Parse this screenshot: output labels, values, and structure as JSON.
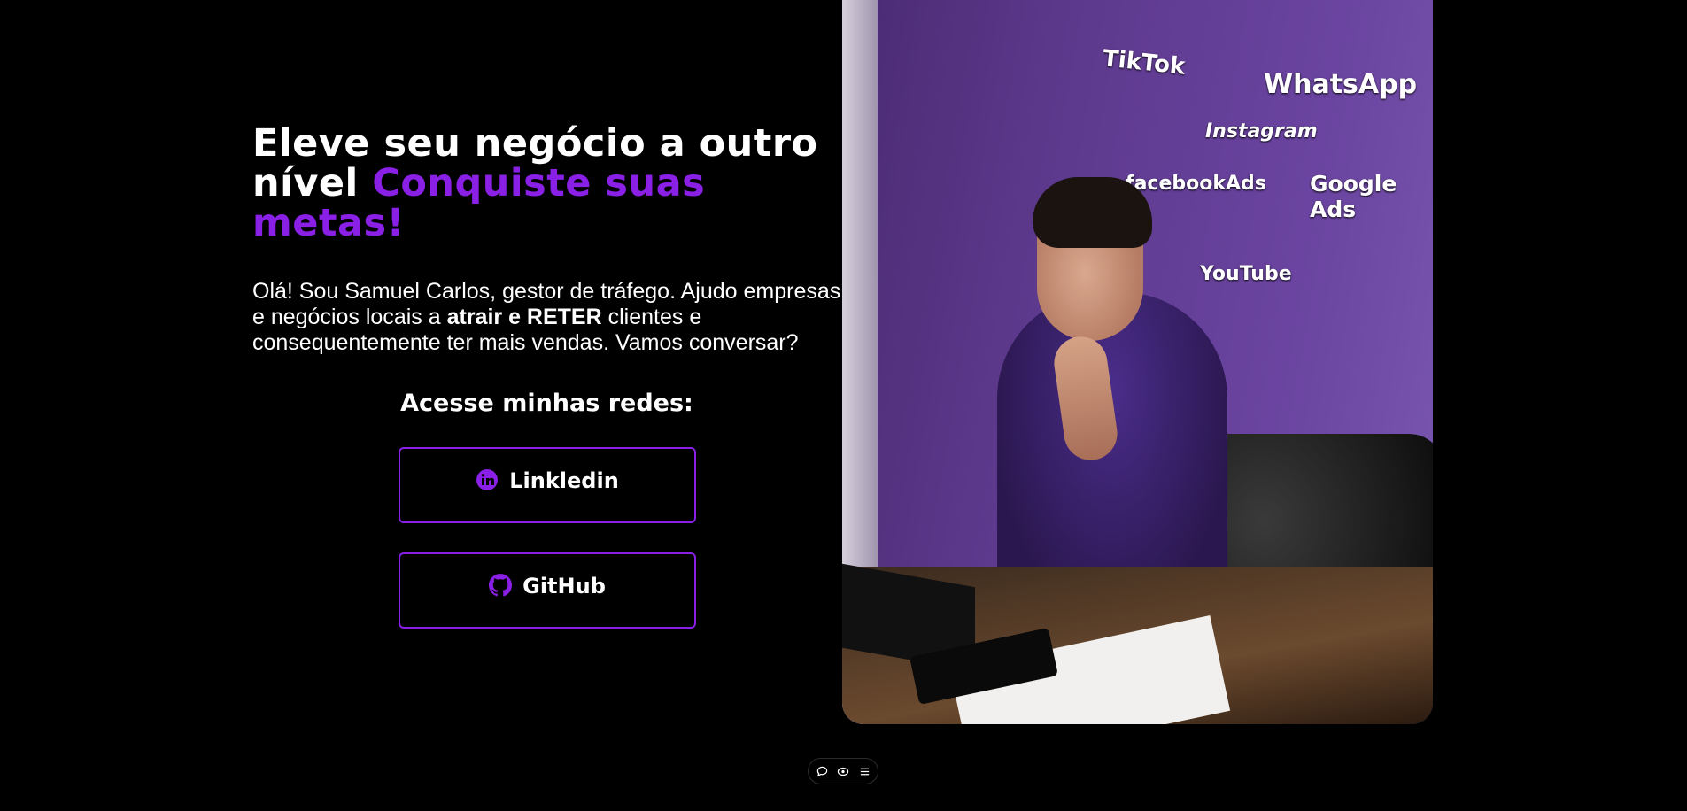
{
  "hero": {
    "title_line": "Eleve seu negócio a outro nível",
    "title_accent": "Conquiste suas metas!",
    "intro_start": "Olá! Sou Samuel Carlos, gestor de tráfego. Ajudo empresas e negócios locais a",
    "intro_bold": "atrair e RETER",
    "intro_end": "clientes e consequentemente ter mais vendas. Vamos conversar?"
  },
  "social": {
    "heading": "Acesse minhas redes:",
    "buttons": [
      {
        "label": "Linkledin",
        "icon": "linkedin-icon"
      },
      {
        "label": "GitHub",
        "icon": "github-icon"
      }
    ]
  },
  "photo": {
    "wall_logos": [
      "TikTok",
      "WhatsApp",
      "Instagram",
      "facebookAds",
      "Google Ads",
      "YouTube"
    ]
  },
  "toolbar": {
    "icons": [
      "chat-icon",
      "eye-icon",
      "menu-icon"
    ]
  },
  "colors": {
    "accent": "#8a1fe6",
    "background": "#000000",
    "text": "#ffffff"
  }
}
